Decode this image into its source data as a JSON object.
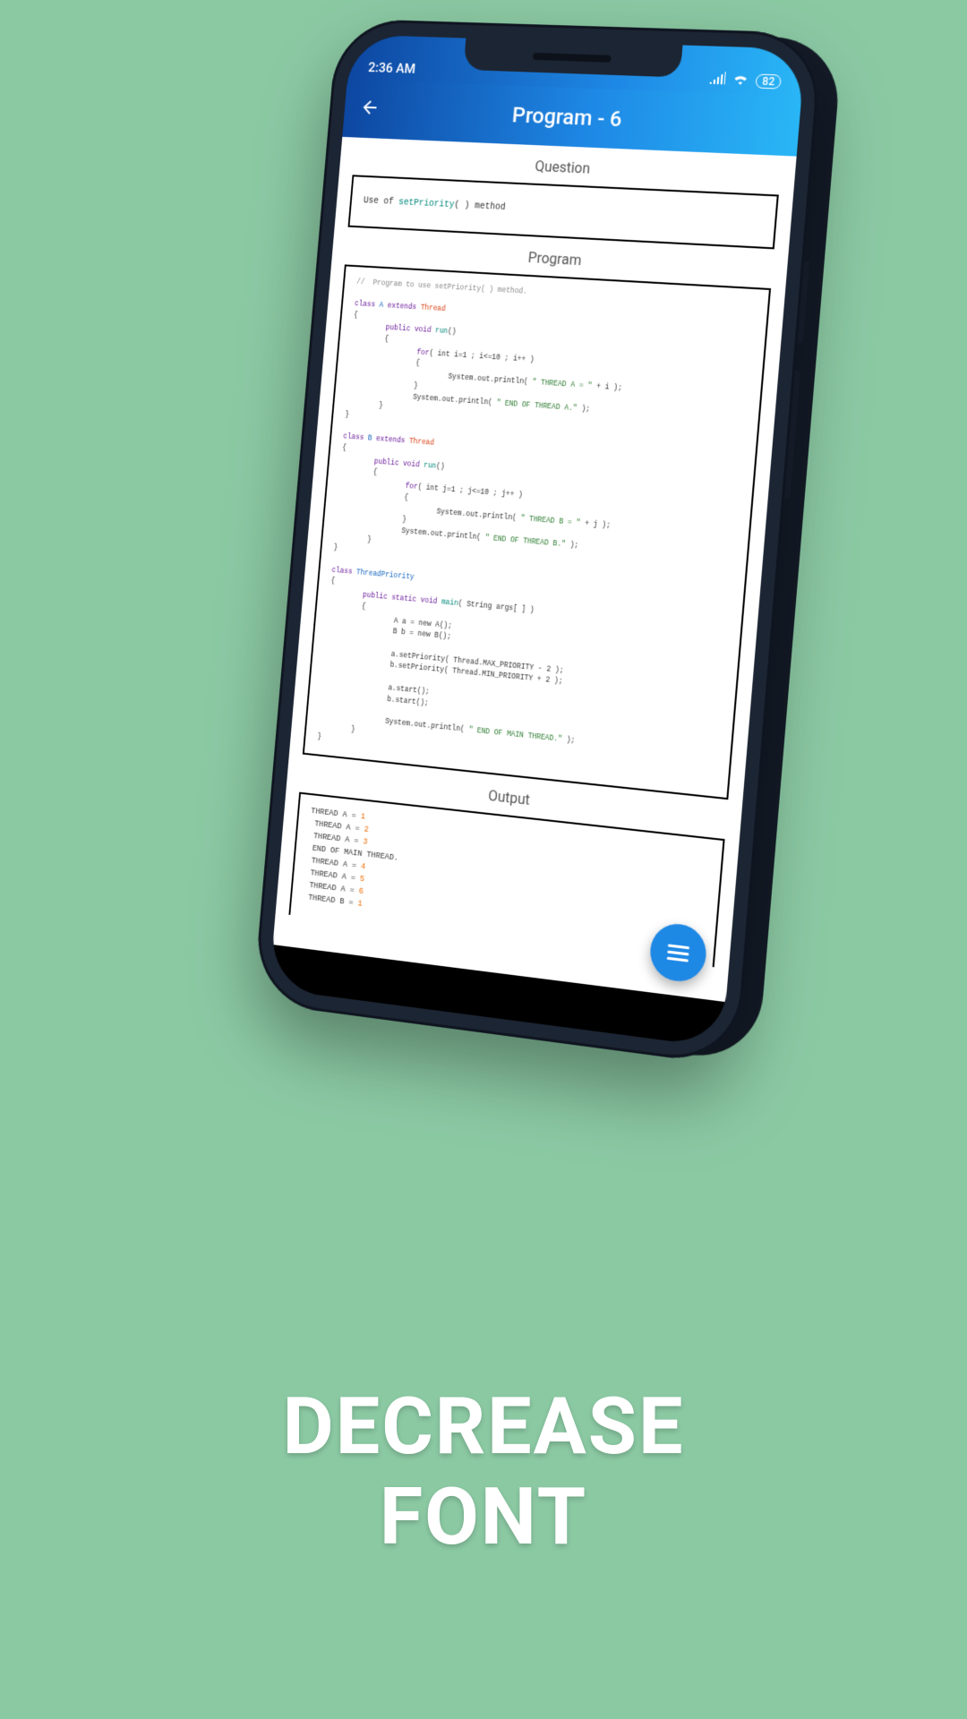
{
  "caption": "DECREASE\nFONT",
  "status": {
    "time": "2:36 AM",
    "battery": "82"
  },
  "appbar": {
    "title": "Program - 6"
  },
  "sections": {
    "question": "Question",
    "program": "Program",
    "output": "Output"
  },
  "question": {
    "prefix": "Use of ",
    "method": "setPriority",
    "suffix": "( ) method"
  },
  "code": {
    "comment": "//  Program to use setPriority( ) method.",
    "classA": {
      "decl": {
        "kw1": "class",
        "name": "A",
        "kw2": "extends",
        "parent": "Thread"
      },
      "run": {
        "kw": "public void",
        "name": "run",
        "sig": "()"
      },
      "for": {
        "kw": "for",
        "body": "( int i=1 ; i<=10 ; i++ )"
      },
      "print": {
        "call": "System.out.println( ",
        "lit": "\" THREAD A = \"",
        "tail": " + i );"
      },
      "end": {
        "call": "System.out.println( ",
        "lit": "\" END OF THREAD A.\"",
        "tail": " );"
      }
    },
    "classB": {
      "decl": {
        "kw1": "class",
        "name": "B",
        "kw2": "extends",
        "parent": "Thread"
      },
      "run": {
        "kw": "public void",
        "name": "run",
        "sig": "()"
      },
      "for": {
        "kw": "for",
        "body": "( int j=1 ; j<=10 ; j++ )"
      },
      "print": {
        "call": "System.out.println( ",
        "lit": "\" THREAD B = \"",
        "tail": " + j );"
      },
      "end": {
        "call": "System.out.println( ",
        "lit": "\" END OF THREAD B.\"",
        "tail": " );"
      }
    },
    "main": {
      "decl": {
        "kw": "class",
        "name": "ThreadPriority"
      },
      "sig": {
        "kw": "public static void",
        "name": "main",
        "args": "( String args[ ] )"
      },
      "body": {
        "newA": "A a = new A();",
        "newB": "B b = new B();",
        "p1": "a.setPriority( Thread.MAX_PRIORITY - 2 );",
        "p2": "b.setPriority( Thread.MIN_PRIORITY + 2 );",
        "s1": "a.start();",
        "s2": "b.start();",
        "end": {
          "call": "System.out.println( ",
          "lit": "\" END OF MAIN THREAD.\"",
          "tail": " );"
        }
      }
    }
  },
  "output": [
    {
      "t": "THREAD A = ",
      "n": "1"
    },
    {
      "t": " THREAD A = ",
      "n": "2"
    },
    {
      "t": " THREAD A = ",
      "n": "3"
    },
    {
      "t": " END OF MAIN THREAD.",
      "n": ""
    },
    {
      "t": " THREAD A = ",
      "n": "4"
    },
    {
      "t": " THREAD A = ",
      "n": "5"
    },
    {
      "t": " THREAD A = ",
      "n": "6"
    },
    {
      "t": " THREAD B = ",
      "n": "1"
    }
  ]
}
